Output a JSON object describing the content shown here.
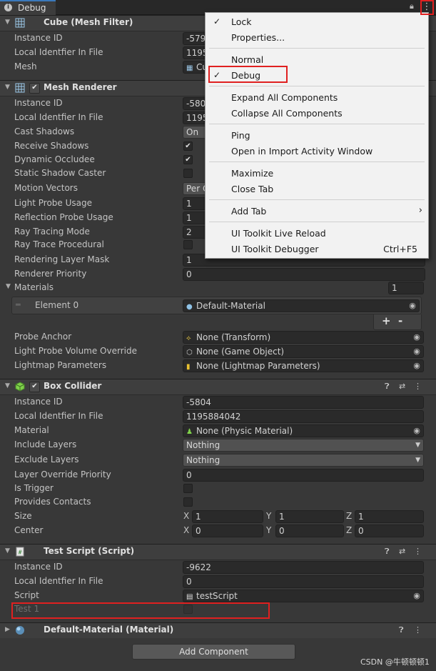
{
  "tab": {
    "title": "Debug"
  },
  "mesh_filter": {
    "title": "Cube (Mesh Filter)",
    "rows": [
      {
        "label": "Instance ID",
        "value": "-579"
      },
      {
        "label": "Local Identfier In File",
        "value": "1195"
      },
      {
        "label": "Mesh",
        "value": "Cu"
      }
    ]
  },
  "mesh_renderer": {
    "title": "Mesh Renderer",
    "instance_id": {
      "label": "Instance ID",
      "value": "-580"
    },
    "local_id": {
      "label": "Local Identfier In File",
      "value": "1195"
    },
    "cast_shadows": {
      "label": "Cast Shadows",
      "value": "On"
    },
    "receive_shadows": {
      "label": "Receive Shadows",
      "checked": "✔"
    },
    "dynamic_occludee": {
      "label": "Dynamic Occludee",
      "checked": "✔"
    },
    "static_shadow": {
      "label": "Static Shadow Caster"
    },
    "motion_vectors": {
      "label": "Motion Vectors",
      "value": "Per O"
    },
    "light_probe": {
      "label": "Light Probe Usage",
      "value": "1"
    },
    "reflection_probe": {
      "label": "Reflection Probe Usage",
      "value": "1"
    },
    "ray_tracing_mode": {
      "label": "Ray Tracing Mode",
      "value": "2"
    },
    "ray_trace_procedural": {
      "label": "Ray Trace Procedural"
    },
    "rendering_layer_mask": {
      "label": "Rendering Layer Mask",
      "value": "1"
    },
    "renderer_priority": {
      "label": "Renderer Priority",
      "value": "0"
    },
    "materials": {
      "label": "Materials",
      "count": "1"
    },
    "element0": {
      "label": "Element 0",
      "value": "Default-Material"
    },
    "plus": "+",
    "minus": "-",
    "probe_anchor": {
      "label": "Probe Anchor",
      "value": "None (Transform)"
    },
    "lpv_override": {
      "label": "Light Probe Volume Override",
      "value": "None (Game Object)"
    },
    "lightmap_params": {
      "label": "Lightmap Parameters",
      "value": "None (Lightmap Parameters)"
    }
  },
  "box_collider": {
    "title": "Box Collider",
    "instance_id": {
      "label": "Instance ID",
      "value": "-5804"
    },
    "local_id": {
      "label": "Local Identfier In File",
      "value": "1195884042"
    },
    "material": {
      "label": "Material",
      "value": "None (Physic Material)"
    },
    "include_layers": {
      "label": "Include Layers",
      "value": "Nothing"
    },
    "exclude_layers": {
      "label": "Exclude Layers",
      "value": "Nothing"
    },
    "layer_override": {
      "label": "Layer Override Priority",
      "value": "0"
    },
    "is_trigger": {
      "label": "Is Trigger"
    },
    "provides_contacts": {
      "label": "Provides Contacts"
    },
    "size": {
      "label": "Size",
      "x": "1",
      "y": "1",
      "z": "1"
    },
    "center": {
      "label": "Center",
      "x": "0",
      "y": "0",
      "z": "0"
    },
    "axis_x": "X",
    "axis_y": "Y",
    "axis_z": "Z"
  },
  "test_script": {
    "title": "Test Script (Script)",
    "instance_id": {
      "label": "Instance ID",
      "value": "-9622"
    },
    "local_id": {
      "label": "Local Identfier In File",
      "value": "0"
    },
    "script": {
      "label": "Script",
      "value": "testScript"
    },
    "test1": {
      "label": "Test 1"
    }
  },
  "material_component": {
    "title": "Default-Material (Material)"
  },
  "add_component": "Add Component",
  "menu": {
    "lock": "Lock",
    "properties": "Properties...",
    "normal": "Normal",
    "debug": "Debug",
    "expand_all": "Expand All Components",
    "collapse_all": "Collapse All Components",
    "ping": "Ping",
    "open_import": "Open in Import Activity Window",
    "maximize": "Maximize",
    "close_tab": "Close Tab",
    "add_tab": "Add Tab",
    "ui_live_reload": "UI Toolkit Live Reload",
    "ui_debugger": "UI Toolkit Debugger",
    "ui_debugger_shortcut": "Ctrl+F5",
    "check": "✓",
    "submenu_arrow": "›"
  },
  "watermark": "CSDN @牛顿顿顿1"
}
